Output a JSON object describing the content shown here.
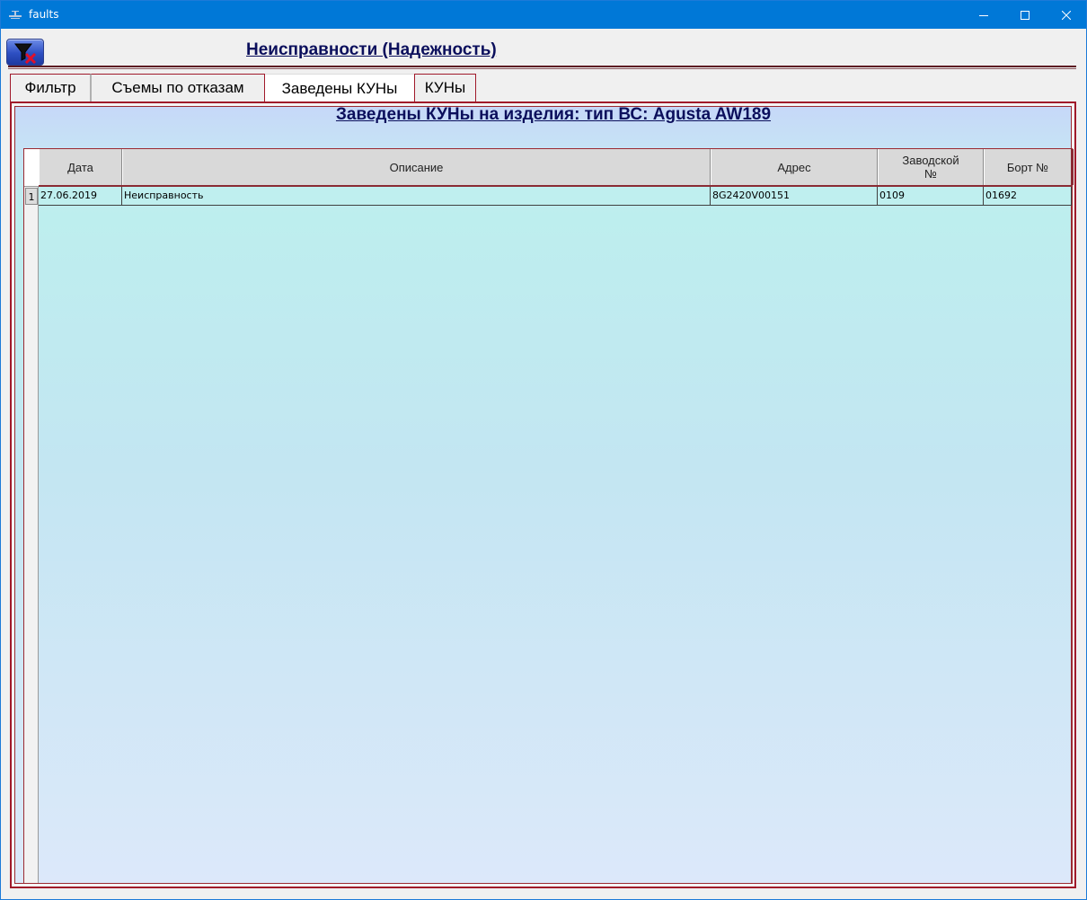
{
  "window": {
    "title": "faults",
    "titlebar_color": "#0078d7",
    "icon": "app-icon"
  },
  "header": {
    "title": "Неисправности (Надежность)",
    "filter_clear_icon": "filter-clear-icon",
    "title_color": "#0b0f5c"
  },
  "tabs": [
    {
      "label": "Фильтр",
      "active": false
    },
    {
      "label": "Съемы по отказам",
      "active": false
    },
    {
      "label": "Заведены КУНы",
      "active": true
    },
    {
      "label": "КУНы",
      "active": false
    }
  ],
  "panel": {
    "heading": "Заведены КУНы на изделия:  тип ВС: Agusta AW189",
    "accent_color": "#a0192a"
  },
  "grid": {
    "columns": [
      "Дата",
      "Описание",
      "Адрес",
      "Заводской №",
      "Борт №"
    ],
    "rows": [
      {
        "num": "1",
        "date": "27.06.2019",
        "description": "Неисправность",
        "address": "8G2420V00151",
        "serial": "0109",
        "board": "01692"
      }
    ],
    "row_color": "#bfefef"
  }
}
